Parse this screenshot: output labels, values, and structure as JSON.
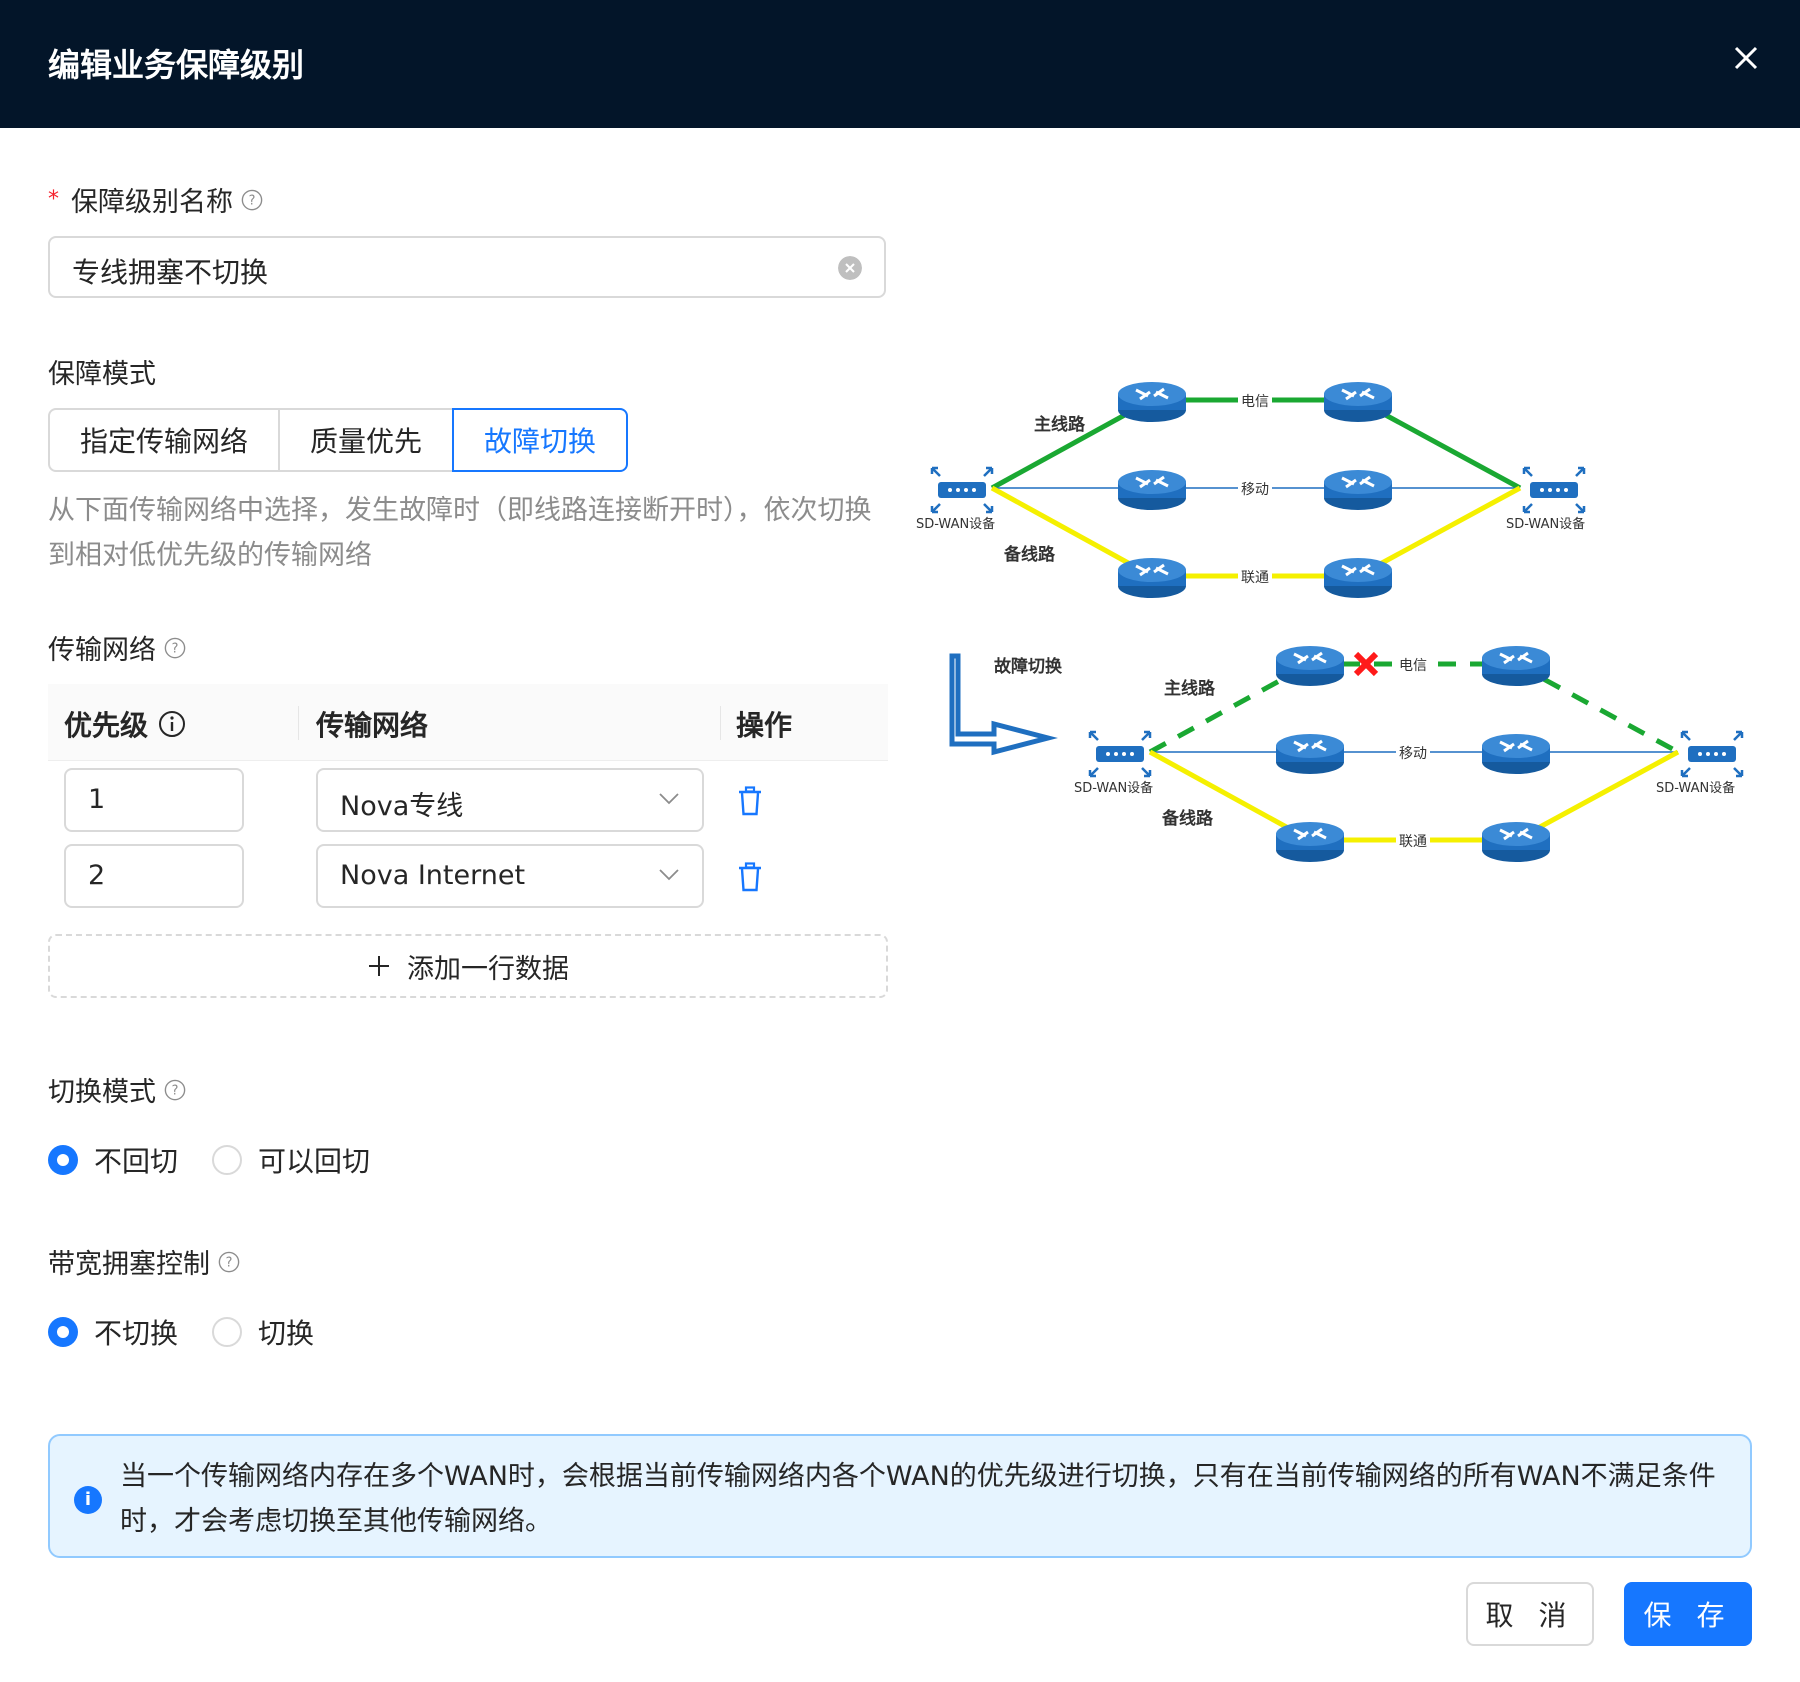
{
  "dialog": {
    "title": "编辑业务保障级别",
    "close_label": "关闭"
  },
  "form": {
    "name_label": "保障级别名称",
    "name_value": "专线拥塞不切换",
    "mode_label": "保障模式",
    "modes": [
      "指定传输网络",
      "质量优先",
      "故障切换"
    ],
    "active_mode": "故障切换",
    "mode_description": "从下面传输网络中选择，发生故障时（即线路连接断开时），依次切换到相对低优先级的传输网络",
    "network_label": "传输网络",
    "table": {
      "headers": [
        "优先级",
        "传输网络",
        "操作"
      ],
      "rows": [
        {
          "priority": "1",
          "network": "Nova专线"
        },
        {
          "priority": "2",
          "network": "Nova Internet"
        }
      ],
      "add_row_label": "添加一行数据"
    },
    "switch_mode_label": "切换模式",
    "switch_mode_options": [
      "不回切",
      "可以回切"
    ],
    "switch_mode_selected": "不回切",
    "bandwidth_label": "带宽拥塞控制",
    "bandwidth_options": [
      "不切换",
      "切换"
    ],
    "bandwidth_selected": "不切换"
  },
  "diagram": {
    "top": {
      "main_line": "主线路",
      "backup_line": "备线路",
      "links": [
        "电信",
        "移动",
        "联通"
      ],
      "device_left": "SD-WAN设备",
      "device_right": "SD-WAN设备"
    },
    "bottom": {
      "failover_label": "故障切换",
      "main_line": "主线路",
      "backup_line": "备线路",
      "links": [
        "电信",
        "移动",
        "联通"
      ],
      "device_left": "SD-WAN设备",
      "device_right": "SD-WAN设备"
    },
    "colors": {
      "main": "#1aa832",
      "backup": "#f5f000",
      "mid": "#1f6fc0",
      "router": "#1f6fc0",
      "fault": "#ff1a1a"
    }
  },
  "alert": {
    "text": "当一个传输网络内存在多个WAN时，会根据当前传输网络内各个WAN的优先级进行切换，只有在当前传输网络的所有WAN不满足条件时，才会考虑切换至其他传输网络。"
  },
  "footer": {
    "cancel_label": "取 消",
    "save_label": "保 存"
  }
}
